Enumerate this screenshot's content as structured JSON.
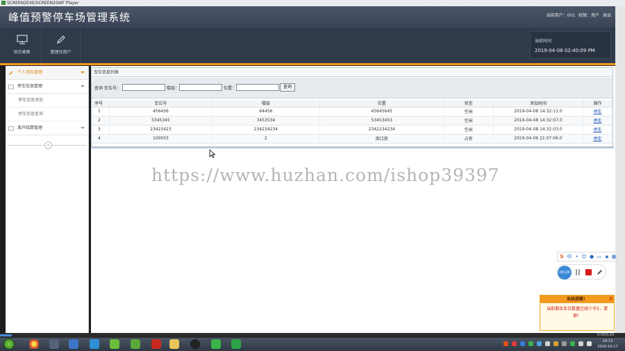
{
  "player": {
    "title": "SCREEN2EXE/SCREEN2SWF Player",
    "elapsed": "0:00/0:29",
    "progress_fraction": 0.02
  },
  "app": {
    "title": "峰值预警停车场管理系统",
    "user_label": "当前用户：001",
    "role_label": "权限：用户",
    "logout_label": "退出"
  },
  "toolbar": {
    "items": [
      {
        "label": "显示桌面",
        "icon": "monitor-icon"
      },
      {
        "label": "管理员用户",
        "icon": "pencil-icon"
      }
    ],
    "time_label": "当前时间",
    "time_value": "2019-04-08 02:40:09 PM"
  },
  "sidebar": {
    "groups": [
      {
        "label": "个人资料管理",
        "icon": "edit-icon",
        "active": true
      },
      {
        "label": "停车信息管理",
        "icon": "folder-icon"
      },
      {
        "label": "离开结算管理",
        "icon": "folder-icon"
      }
    ],
    "subitems": [
      "停车信息添加",
      "停车信息查询"
    ],
    "collapse_symbol": "«"
  },
  "panel": {
    "title": "车位信息列表",
    "search": {
      "prefix": "查询 车位号：",
      "plate_label": "楼层：",
      "location_label": "位置：",
      "button": "查询",
      "spot_value": "",
      "plate_value": "",
      "location_value": ""
    },
    "columns": [
      "序号",
      "车位号",
      "楼层",
      "位置",
      "状态",
      "添加时间",
      "操作"
    ],
    "rows": [
      {
        "no": "1",
        "spot": "456456",
        "floor": "64456",
        "location": "45645645",
        "status": "空闲",
        "time": "2019-04-08 14:32:11.0",
        "action": "停车"
      },
      {
        "no": "2",
        "spot": "5345345",
        "floor": "3453534",
        "location": "53453453",
        "status": "空闲",
        "time": "2019-04-08 14:32:07.0",
        "action": "停车"
      },
      {
        "no": "3",
        "spot": "23423423",
        "floor": "234234234",
        "location": "2342234234",
        "status": "空闲",
        "time": "2019-04-08 14:32:03.0",
        "action": "停车"
      },
      {
        "no": "4",
        "spot": "100003",
        "floor": "2",
        "location": "南口南",
        "status": "占有",
        "time": "2019-04-06 21:07:06.0",
        "action": "停车"
      }
    ]
  },
  "watermark": "https://www.huzhan.com/ishop39397",
  "ime": {
    "label": "中"
  },
  "recorder": {
    "time": "00:24"
  },
  "notice": {
    "title": "系统提醒！",
    "close": "X",
    "message": "当前剩余车位数量已经少于5，请谢！"
  },
  "taskbar": {
    "time": "19:13",
    "date": "2020-10-17"
  },
  "colors": {
    "header": "#3b4456",
    "accent": "#f39a1e",
    "link": "#1a4fb3",
    "notice_text": "#d01010"
  }
}
